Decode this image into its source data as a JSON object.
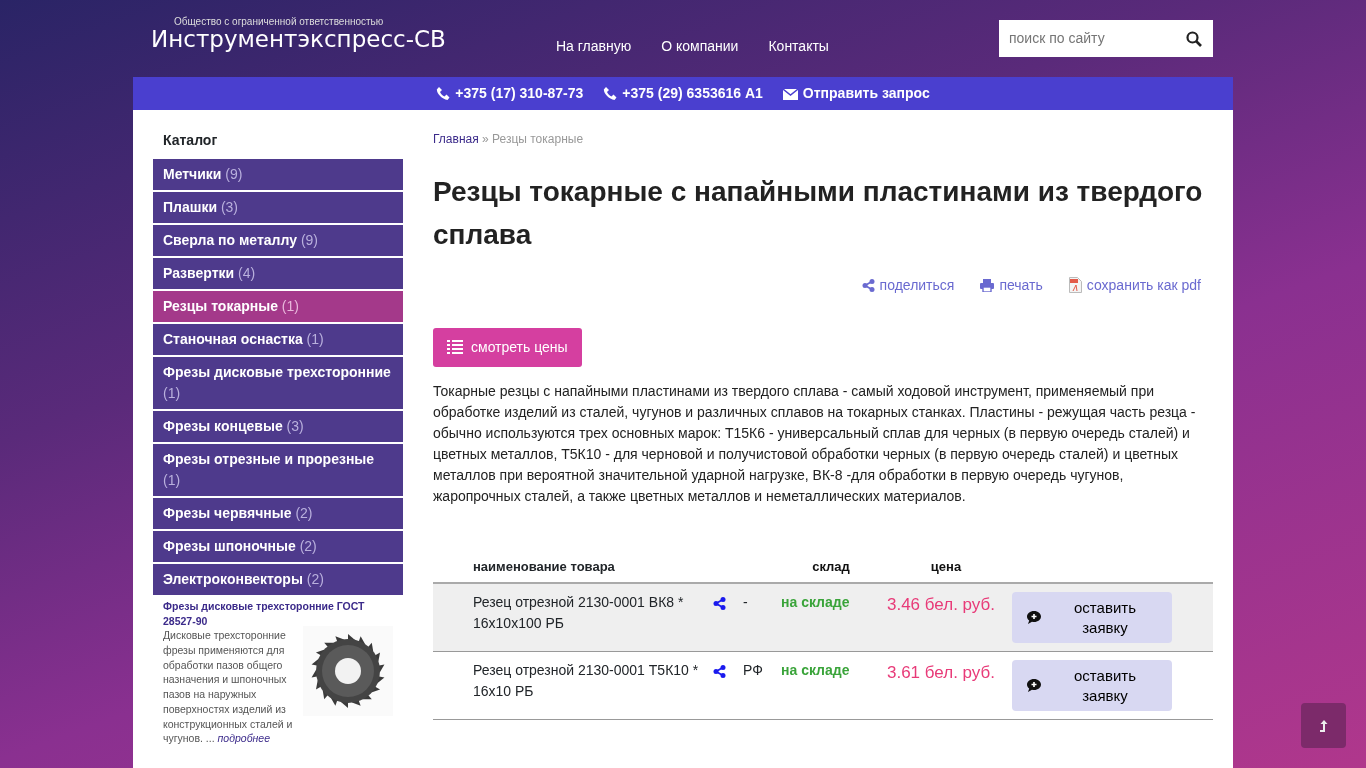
{
  "header": {
    "tagline": "Общество с ограниченной ответственностью",
    "logo": "Инструментэкспресс-СВ",
    "nav": [
      {
        "label": "На главную"
      },
      {
        "label": "О компании"
      },
      {
        "label": "Контакты"
      }
    ],
    "search": {
      "placeholder": "поиск по сайту"
    }
  },
  "contact_bar": [
    {
      "kind": "phone",
      "label": "+375 (17) 310-87-73"
    },
    {
      "kind": "phone",
      "label": "+375 (29) 6353616 А1"
    },
    {
      "kind": "mail",
      "label": "Отправить запрос"
    }
  ],
  "sidebar": {
    "title": "Каталог",
    "items": [
      {
        "label": "Метчики",
        "count": "(9)",
        "selected": false
      },
      {
        "label": "Плашки",
        "count": "(3)",
        "selected": false
      },
      {
        "label": "Сверла по металлу",
        "count": "(9)",
        "selected": false
      },
      {
        "label": "Развертки",
        "count": "(4)",
        "selected": false
      },
      {
        "label": "Резцы токарные",
        "count": "(1)",
        "selected": true
      },
      {
        "label": "Станочная оснастка",
        "count": "(1)",
        "selected": false
      },
      {
        "label": "Фрезы дисковые трехсторонние",
        "count": "(1)",
        "selected": false
      },
      {
        "label": "Фрезы концевые",
        "count": "(3)",
        "selected": false
      },
      {
        "label": "Фрезы отрезные и прорезные",
        "count": "(1)",
        "selected": false
      },
      {
        "label": "Фрезы червячные",
        "count": "(2)",
        "selected": false
      },
      {
        "label": "Фрезы шпоночные",
        "count": "(2)",
        "selected": false
      },
      {
        "label": "Электроконвекторы",
        "count": "(2)",
        "selected": false
      }
    ],
    "feature": {
      "title": "Фрезы дисковые трехсторонние ГОСТ 28527-90",
      "text": "Дисковые трехсторонние фрезы применяются для обработки пазов общего назначения и шпоночных пазов на наружных поверхностях изделий из конструкционных сталей и чугунов. ...",
      "more": "подробнее"
    }
  },
  "breadcrumb": [
    {
      "label": "Главная",
      "current": false
    },
    {
      "label": "Резцы токарные",
      "current": true
    }
  ],
  "breadcrumb_separator": "»",
  "title": "Резцы токарные с напайными пластинами из твердого сплава",
  "actions": [
    {
      "kind": "share",
      "label": "поделиться"
    },
    {
      "kind": "print",
      "label": "печать"
    },
    {
      "kind": "pdf",
      "label": "сохранить как pdf"
    }
  ],
  "prices_button": "смотреть цены",
  "description": "Токарные резцы с напайными пластинами из твердого сплава - самый ходовой инструмент, применяемый при обработке изделий из сталей, чугунов и различных сплавов на токарных станках. Пластины - режущая часть резца - обычно используются трех основных марок: Т15К6 - универсальный сплав для черных (в первую очередь сталей) и цветных металлов, Т5К10 - для черновой и получистовой обработки черных (в первую очередь сталей) и цветных металлов при вероятной значительной ударной нагрузке, ВК-8 -для обработки в первую очередь чугунов, жаропрочных сталей, а также цветных металлов и неметаллических материалов.",
  "table": {
    "columns": [
      "наименование товара",
      "склад",
      "цена"
    ],
    "rows": [
      {
        "name": "Резец отрезной 2130-0001 ВК8 * 16х10х100 РБ",
        "origin": "-",
        "stock": "на складе",
        "price": "3.46 бел. руб.",
        "button": "оставить заявку",
        "highlighted": true
      },
      {
        "name": "Резец отрезной 2130-0001 Т5К10 * 16х10 РБ",
        "origin": "РФ",
        "stock": "на складе",
        "price": "3.61 бел. руб.",
        "button": "оставить заявку",
        "highlighted": false
      }
    ]
  }
}
